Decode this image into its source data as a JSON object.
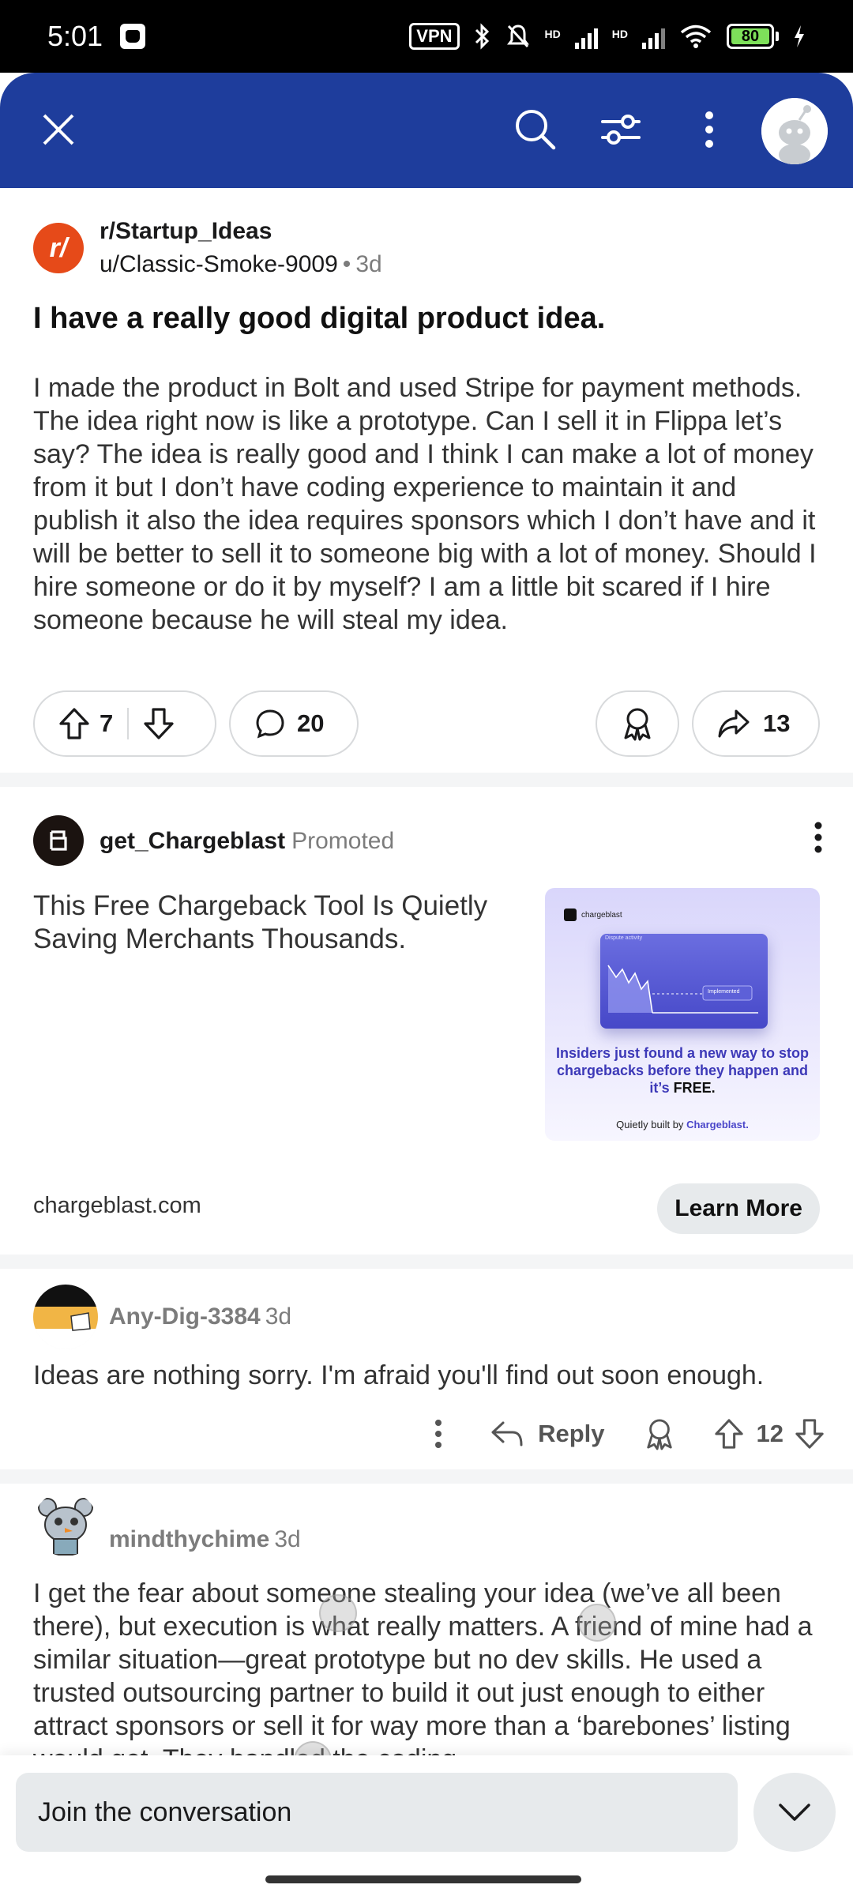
{
  "status_bar": {
    "time": "5:01",
    "vpn": "VPN",
    "net1": "HD",
    "net2": "HD",
    "battery": "80",
    "icons": [
      "bluetooth-icon",
      "silent-icon",
      "signal-icon",
      "wifi-icon",
      "charging-icon"
    ]
  },
  "header": {
    "icons": [
      "close-icon",
      "search-icon",
      "filter-icon",
      "more-vertical-icon",
      "avatar"
    ],
    "brand_color": "#1e3d9c"
  },
  "post": {
    "subreddit": "r/Startup_Ideas",
    "author": "u/Classic-Smoke-9009",
    "separator": "•",
    "age": "3d",
    "title": "I have a really good digital product idea.",
    "body": "I made the product in Bolt and used Stripe for payment methods. The idea right now is like a prototype. Can I sell it in Flippa let’s say? The idea is really good and I think I can make a lot of money from it but I don’t have coding experience to maintain it and publish it also the idea requires sponsors which I don’t have and it will be better to sell it to someone big with a lot of money. Should I hire someone or do it by myself? I am a little bit scared if I hire someone because he will steal my idea.",
    "votes": "7",
    "comments": "20",
    "shares": "13"
  },
  "ad": {
    "name": "get_Chargeblast",
    "promoted": "Promoted",
    "headline": "This Free Chargeback Tool Is Quietly Saving Merchants Thousands.",
    "image": {
      "brand": "chargeblast",
      "card_label": "Dispute activity",
      "card_tag": "Implemented",
      "text_main": "Insiders just found a new way to stop chargebacks before they happen and it’s",
      "text_free": "FREE.",
      "footer_prefix": "Quietly built by",
      "footer_brand": "Chargeblast."
    },
    "domain": "chargeblast.com",
    "cta": "Learn More"
  },
  "comments": [
    {
      "author": "Any-Dig-3384",
      "age": "3d",
      "text": "Ideas are nothing sorry. I'm afraid you'll find out soon enough.",
      "reply_label": "Reply",
      "votes": "12"
    },
    {
      "author": "mindthychime",
      "age": "3d",
      "text": "I get the fear about someone stealing your idea (we’ve all been there), but execution is what really matters. A friend of mine had a similar situation—great prototype but no dev skills. He used a trusted outsourcing partner to build it out just enough to either attract sponsors or sell it for way more than a ‘barebones’ listing would get. They handled the coding"
    }
  ],
  "bottom": {
    "placeholder": "Join the conversation"
  }
}
